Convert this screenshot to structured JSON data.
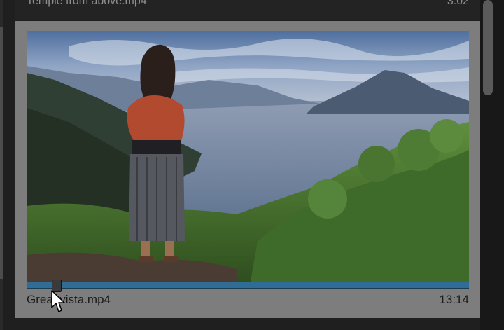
{
  "previous_clip": {
    "title": "Temple from above.mp4",
    "duration": "3:02"
  },
  "selected_clip": {
    "name": "Great vista.mp4",
    "duration": "13:14",
    "playhead_fraction": 0.055
  },
  "icons": {
    "cursor": "arrow-cursor-icon",
    "thumbnail": "video-thumbnail-image"
  },
  "colors": {
    "card": "#7d7d7d",
    "scrub_track": "#2f6d96",
    "background": "#1f1f1f"
  }
}
